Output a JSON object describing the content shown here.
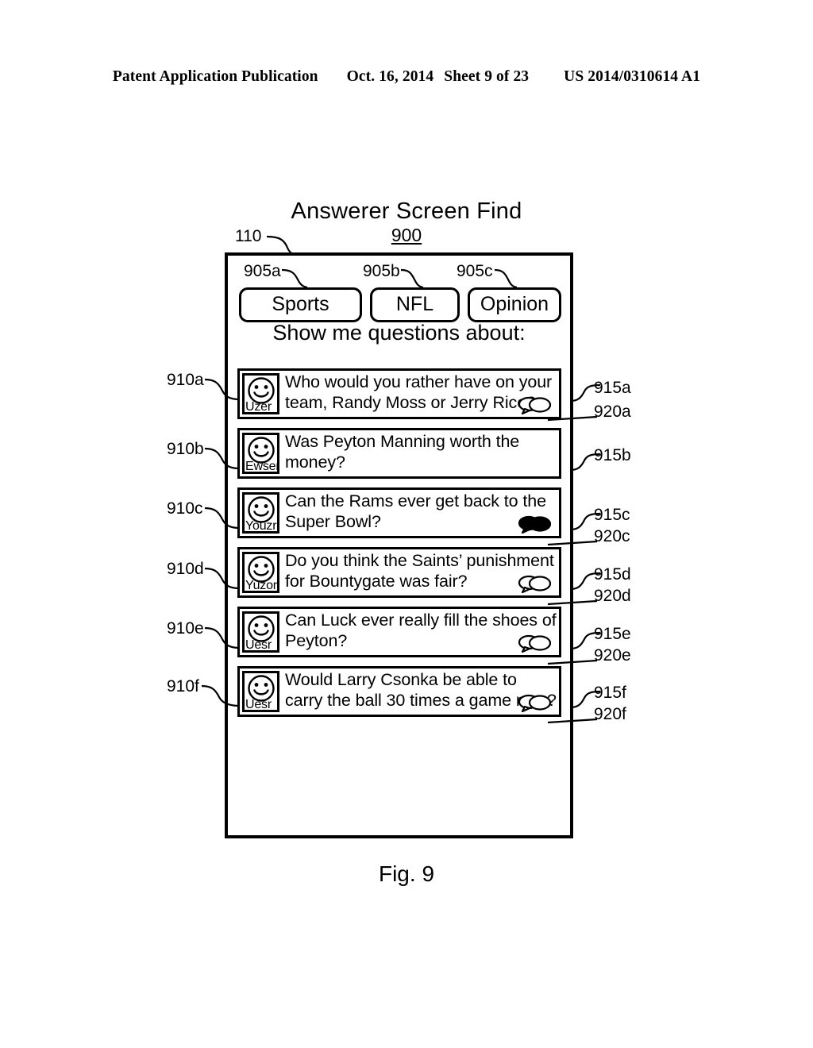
{
  "patent_header": {
    "publication": "Patent Application Publication",
    "date": "Oct. 16, 2014",
    "sheet": "Sheet 9 of 23",
    "number": "US 2014/0310614 A1"
  },
  "figure": {
    "title": "Answerer Screen Find",
    "number": "900",
    "caption": "Fig. 9",
    "device_ref": "110"
  },
  "screen": {
    "tabs": [
      {
        "label": "Sports",
        "ref": "905a"
      },
      {
        "label": "NFL",
        "ref": "905b"
      },
      {
        "label": "Opinion",
        "ref": "905c"
      }
    ],
    "prompt": "Show me questions about:",
    "questions": [
      {
        "ref_item": "910a",
        "ref_text": "915a",
        "ref_bubble": "920a",
        "user": "Uzer",
        "text": "Who would you rather have on your team, Randy Moss or Jerry Rice?",
        "bubble": "outline"
      },
      {
        "ref_item": "910b",
        "ref_text": "915b",
        "ref_bubble": "",
        "user": "Ewser",
        "text": "Was Peyton Manning worth the money?",
        "bubble": "none"
      },
      {
        "ref_item": "910c",
        "ref_text": "915c",
        "ref_bubble": "920c",
        "user": "Youzr",
        "text": "Can the Rams ever get back to the Super Bowl?",
        "bubble": "filled"
      },
      {
        "ref_item": "910d",
        "ref_text": "915d",
        "ref_bubble": "920d",
        "user": "Yuzor",
        "text": "Do you think the Saints’ punishment for Bountygate was fair?",
        "bubble": "outline"
      },
      {
        "ref_item": "910e",
        "ref_text": "915e",
        "ref_bubble": "920e",
        "user": "Uesr",
        "text": "Can Luck ever really fill the shoes of Peyton?",
        "bubble": "outline"
      },
      {
        "ref_item": "910f",
        "ref_text": "915f",
        "ref_bubble": "920f",
        "user": "Uesr",
        "text": "Would Larry Csonka be able to carry the ball 30 times a game now?",
        "bubble": "outline"
      }
    ]
  },
  "colors": {
    "ink": "#000000",
    "paper": "#ffffff"
  }
}
